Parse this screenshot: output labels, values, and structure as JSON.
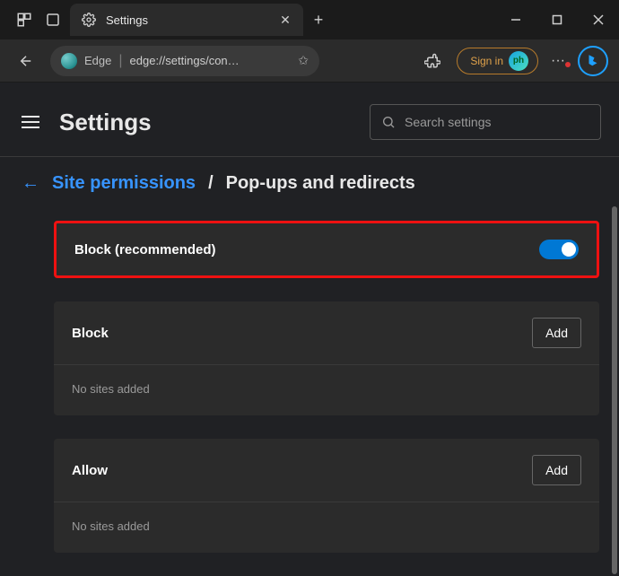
{
  "titlebar": {
    "tab_title": "Settings",
    "gear_icon": "gear-icon"
  },
  "toolbar": {
    "edge_label": "Edge",
    "url": "edge://settings/con…",
    "signin": "Sign in"
  },
  "header": {
    "title": "Settings",
    "search_placeholder": "Search settings"
  },
  "breadcrumb": {
    "parent": "Site permissions",
    "separator": "/",
    "current": "Pop-ups and redirects"
  },
  "sections": {
    "block_recommended": {
      "title": "Block (recommended)",
      "toggle_on": true
    },
    "block": {
      "title": "Block",
      "add_label": "Add",
      "empty": "No sites added"
    },
    "allow": {
      "title": "Allow",
      "add_label": "Add",
      "empty": "No sites added"
    }
  }
}
